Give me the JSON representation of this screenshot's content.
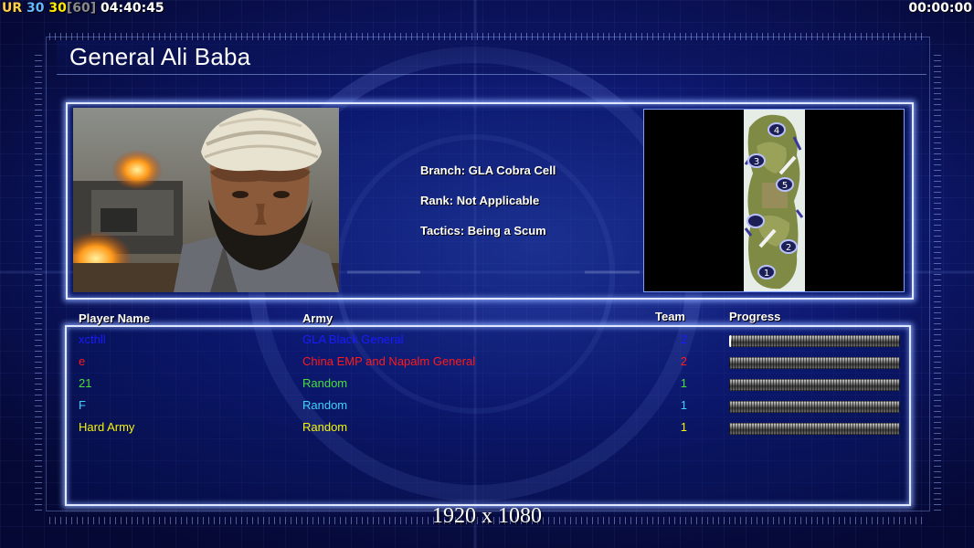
{
  "hud": {
    "left_prefix": "UR",
    "fps_current": "30",
    "fps_logic": "30",
    "fps_cap": "[60]",
    "elapsed": "04:40:45",
    "game_timer": "00:00:00"
  },
  "general": {
    "name": "General Ali Baba",
    "branch": "Branch: GLA Cobra Cell",
    "rank": "Rank: Not Applicable",
    "tactics": "Tactics: Being a Scum"
  },
  "map": {
    "start_positions": [
      "4",
      "3",
      "5",
      "",
      "2",
      "1"
    ]
  },
  "table": {
    "headers": {
      "name": "Player Name",
      "army": "Army",
      "team": "Team",
      "progress": "Progress"
    },
    "players": [
      {
        "name": "xcthll",
        "army": "GLA Black General",
        "team": "2",
        "color": "#1a1aff",
        "progress": 0.01
      },
      {
        "name": "e",
        "army": "China EMP and Napalm General",
        "team": "2",
        "color": "#ff1a1a",
        "progress": 0.0
      },
      {
        "name": "21",
        "army": "Random",
        "team": "1",
        "color": "#4adf3a",
        "progress": 0.0
      },
      {
        "name": "F",
        "army": "Random",
        "team": "1",
        "color": "#3fd0ff",
        "progress": 0.0
      },
      {
        "name": "Hard Army",
        "army": "Random",
        "team": "1",
        "color": "#f5f50a",
        "progress": 0.0
      }
    ]
  },
  "footer": {
    "resolution": "1920 x 1080"
  }
}
